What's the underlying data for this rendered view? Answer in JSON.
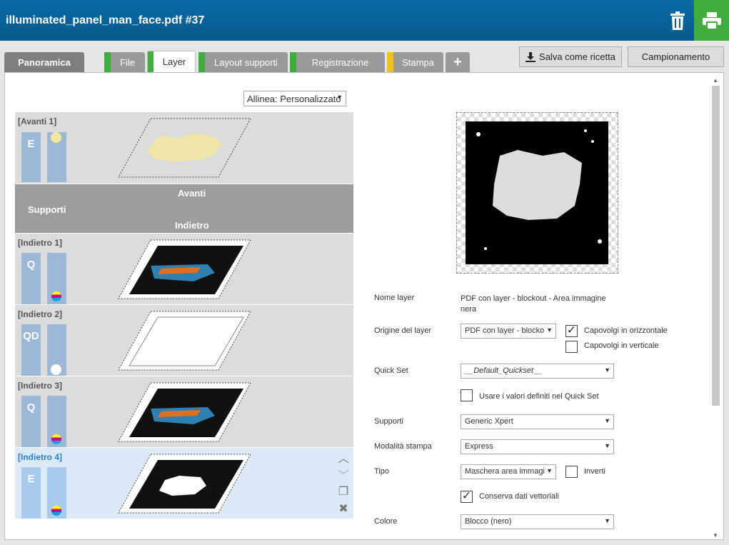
{
  "document_title": "illuminated_panel_man_face.pdf #37",
  "tabs": [
    {
      "label": "Panoramica",
      "marker": ""
    },
    {
      "label": "File",
      "marker": "#3fae3f"
    },
    {
      "label": "Layer",
      "marker": "#3fae3f"
    },
    {
      "label": "Layout supporti",
      "marker": "#3fae3f"
    },
    {
      "label": "Registrazione",
      "marker": "#3fae3f"
    },
    {
      "label": "Stampa",
      "marker": "#f0c020"
    },
    {
      "label": "+",
      "marker": ""
    }
  ],
  "buttons": {
    "save_recipe": "Salva come ricetta",
    "sampling": "Campionamento"
  },
  "align_select": "Allinea: Personalizzato",
  "layers": [
    {
      "name": "[Avanti 1]",
      "letter": "E",
      "indicator": "yellow-dot"
    },
    {
      "name": "[Indietro 1]",
      "letter": "Q",
      "indicator": "cmy"
    },
    {
      "name": "[Indietro 2]",
      "letter": "QD",
      "indicator": "white-dot"
    },
    {
      "name": "[Indietro 3]",
      "letter": "Q",
      "indicator": "cmy"
    },
    {
      "name": "[Indietro 4]",
      "letter": "E",
      "indicator": "cmy"
    }
  ],
  "separator": {
    "front": "Avanti",
    "media": "Supporti",
    "back": "Indietro"
  },
  "properties": {
    "layer_name_label": "Nome layer",
    "layer_name_value": "PDF con layer - blockout - Area immagine nera",
    "origin_label": "Origine del layer",
    "origin_value": "PDF con layer - blocko",
    "flip_h_label": "Capovolgi in orizzontale",
    "flip_v_label": "Capovolgi in verticale",
    "quickset_label": "Quick Set",
    "quickset_value": "__Default_Quickset__",
    "use_quickset_label": "Usare i valori definiti nel Quick Set",
    "media_label": "Supporti",
    "media_value": "Generic Xpert",
    "print_mode_label": "Modalità stampa",
    "print_mode_value": "Express",
    "type_label": "Tipo",
    "type_value": "Maschera area immagi",
    "invert_label": "Inverti",
    "keep_vector_label": "Conserva dati vettoriali",
    "color_label": "Colore",
    "color_value": "Blocco (nero)"
  },
  "checkboxes": {
    "flip_h": true,
    "flip_v": false,
    "use_quickset": false,
    "invert": false,
    "keep_vector": true
  },
  "colors": {
    "title_bar": "#075a8c",
    "print_button": "#3fae3f",
    "selected_layer": "#dce9f6",
    "layer_bar": "#9bb8d6"
  }
}
